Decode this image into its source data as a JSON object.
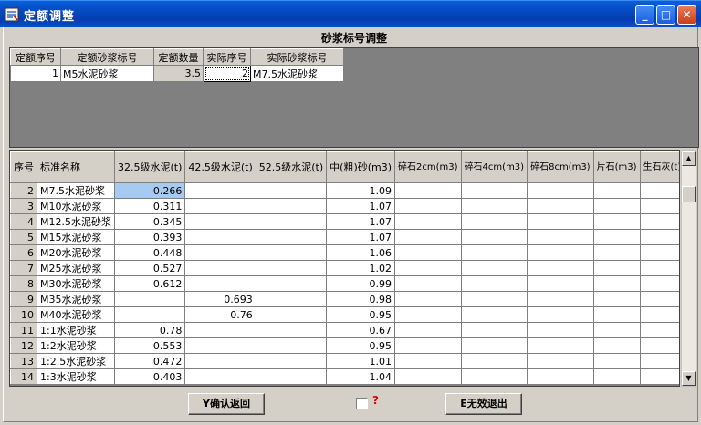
{
  "window": {
    "title": "定额调整",
    "controls": {
      "minimize": "_",
      "maximize": "□",
      "close": "✕"
    }
  },
  "section_title": "砂浆标号调整",
  "top_grid": {
    "headers": [
      "定额序号",
      "定额砂浆标号",
      "定额数量",
      "实际序号",
      "实际砂浆标号"
    ],
    "row": {
      "seq": "1",
      "mortar": "M5水泥砂浆",
      "qty": "3.5",
      "actual_seq": "2",
      "actual_mortar": "M7.5水泥砂浆"
    }
  },
  "main_grid": {
    "headers": {
      "rownum": "序号",
      "name": "标准名称",
      "c325": "32.5级水泥(t)",
      "c425": "42.5级水泥(t)",
      "c525": "52.5级水泥(t)",
      "sand": "中(粗)砂(m3)",
      "gravel2": "碎石2cm(m3)",
      "gravel4": "碎石4cm(m3)",
      "gravel8": "碎石8cm(m3)",
      "stone": "片石(m3)",
      "lime": "生石灰(t)"
    },
    "rows": [
      {
        "no": "2",
        "name": "M7.5水泥砂浆",
        "c325": "0.266",
        "c425": "",
        "c525": "",
        "sand": "1.09"
      },
      {
        "no": "3",
        "name": "M10水泥砂浆",
        "c325": "0.311",
        "c425": "",
        "c525": "",
        "sand": "1.07"
      },
      {
        "no": "4",
        "name": "M12.5水泥砂浆",
        "c325": "0.345",
        "c425": "",
        "c525": "",
        "sand": "1.07"
      },
      {
        "no": "5",
        "name": "M15水泥砂浆",
        "c325": "0.393",
        "c425": "",
        "c525": "",
        "sand": "1.07"
      },
      {
        "no": "6",
        "name": "M20水泥砂浆",
        "c325": "0.448",
        "c425": "",
        "c525": "",
        "sand": "1.06"
      },
      {
        "no": "7",
        "name": "M25水泥砂浆",
        "c325": "0.527",
        "c425": "",
        "c525": "",
        "sand": "1.02"
      },
      {
        "no": "8",
        "name": "M30水泥砂浆",
        "c325": "0.612",
        "c425": "",
        "c525": "",
        "sand": "0.99"
      },
      {
        "no": "9",
        "name": "M35水泥砂浆",
        "c325": "",
        "c425": "0.693",
        "c525": "",
        "sand": "0.98"
      },
      {
        "no": "10",
        "name": "M40水泥砂浆",
        "c325": "",
        "c425": "0.76",
        "c525": "",
        "sand": "0.95"
      },
      {
        "no": "11",
        "name": "1:1水泥砂浆",
        "c325": "0.78",
        "c425": "",
        "c525": "",
        "sand": "0.67"
      },
      {
        "no": "12",
        "name": "1:2水泥砂浆",
        "c325": "0.553",
        "c425": "",
        "c525": "",
        "sand": "0.95"
      },
      {
        "no": "13",
        "name": "1:2.5水泥砂浆",
        "c325": "0.472",
        "c425": "",
        "c525": "",
        "sand": "1.01"
      },
      {
        "no": "14",
        "name": "1:3水泥砂浆",
        "c325": "0.403",
        "c425": "",
        "c525": "",
        "sand": "1.04"
      }
    ]
  },
  "buttons": {
    "ok": "Y确认返回",
    "cancel": "E无效退出"
  },
  "check_label": "?",
  "colors": {
    "selected_cell": "#a6caf0",
    "titlebar": "#0548c0",
    "question": "#e00000"
  }
}
